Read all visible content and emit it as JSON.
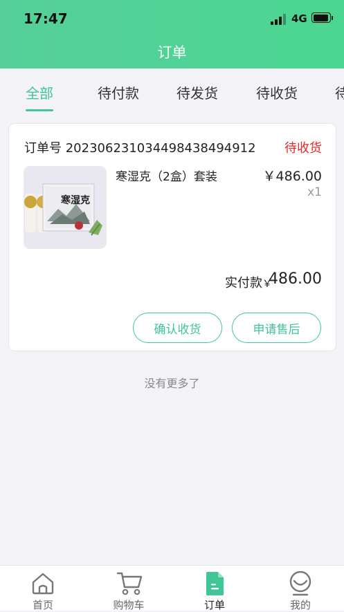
{
  "status_bar": {
    "time": "17:47",
    "network": "4G"
  },
  "header": {
    "title": "订单"
  },
  "tabs": [
    {
      "label": "全部",
      "active": true
    },
    {
      "label": "待付款",
      "active": false
    },
    {
      "label": "待发货",
      "active": false
    },
    {
      "label": "待收货",
      "active": false
    },
    {
      "label": "待评价",
      "active": false
    }
  ],
  "order": {
    "order_no_label": "订单号",
    "order_no": "202306231034498438494912",
    "status": "待收货",
    "product": {
      "name": "寒湿克（2盒）套装",
      "price": "￥486.00",
      "quantity": "x1",
      "image_text": "寒湿克"
    },
    "paid_label": "实付款",
    "paid_currency": "￥",
    "paid_amount": "486.00",
    "buttons": {
      "confirm": "确认收货",
      "after_sale": "申请售后"
    }
  },
  "list_footer": "没有更多了",
  "bottom_nav": [
    {
      "label": "首页",
      "icon": "home-icon",
      "active": false
    },
    {
      "label": "购物车",
      "icon": "cart-icon",
      "active": false
    },
    {
      "label": "订单",
      "icon": "order-document-icon",
      "active": true
    },
    {
      "label": "我的",
      "icon": "profile-icon",
      "active": false
    }
  ],
  "colors": {
    "accent": "#3fc596",
    "header": "#4fd293",
    "status_red": "#e02a2a"
  }
}
